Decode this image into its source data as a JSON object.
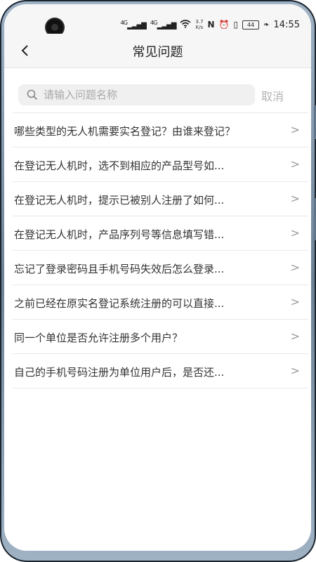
{
  "status_bar": {
    "network_1": "4G",
    "network_2": "4G",
    "speed_value": "3.7",
    "speed_unit": "K/s",
    "battery": "44",
    "time": "14:55"
  },
  "nav": {
    "title": "常见问题",
    "back_icon": "chevron-left-icon"
  },
  "search": {
    "placeholder": "请输入问题名称",
    "value": "",
    "cancel_label": "取消"
  },
  "faq_items": [
    {
      "text": "哪些类型的无人机需要实名登记？由谁来登记？"
    },
    {
      "text": "在登记无人机时，选不到相应的产品型号如..."
    },
    {
      "text": "在登记无人机时，提示已被别人注册了如何..."
    },
    {
      "text": "在登记无人机时，产品序列号等信息填写错..."
    },
    {
      "text": "忘记了登录密码且手机号码失效后怎么登录..."
    },
    {
      "text": "之前已经在原实名登记系统注册的可以直接..."
    },
    {
      "text": "同一个单位是否允许注册多个用户？"
    },
    {
      "text": "自己的手机号码注册为单位用户后，是否还..."
    }
  ],
  "colors": {
    "text": "#333333",
    "muted": "#a8a8a8",
    "divider": "#e9e9e9",
    "header_bg": "#f6f6f6"
  }
}
